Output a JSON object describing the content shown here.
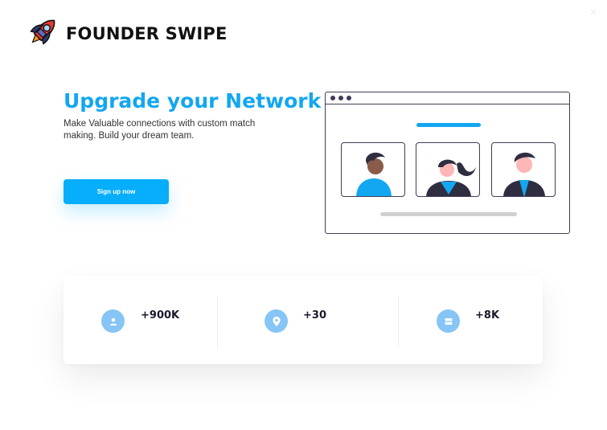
{
  "brand": {
    "name": "FOUNDER SWIPE",
    "logo_icon": "rocket-icon"
  },
  "window": {
    "close_icon": "close-icon",
    "close_glyph": "✕"
  },
  "hero": {
    "title": "Upgrade your Network",
    "subtitle": "Make Valuable connections with custom match making. Build your dream team.",
    "cta_label": "Sign up now"
  },
  "illustration": {
    "icon": "video-call-illustration",
    "people": [
      "person-man-icon",
      "person-woman-icon",
      "person-man-icon"
    ]
  },
  "stats": [
    {
      "icon": "user-icon",
      "value": "+900K"
    },
    {
      "icon": "location-pin-icon",
      "value": "+30"
    },
    {
      "icon": "server-icon",
      "value": "+8K"
    }
  ],
  "colors": {
    "accent": "#12a7f0",
    "button": "#06aefb",
    "stat_icon_bg": "#86c5f5",
    "outline": "#3f3d56"
  }
}
